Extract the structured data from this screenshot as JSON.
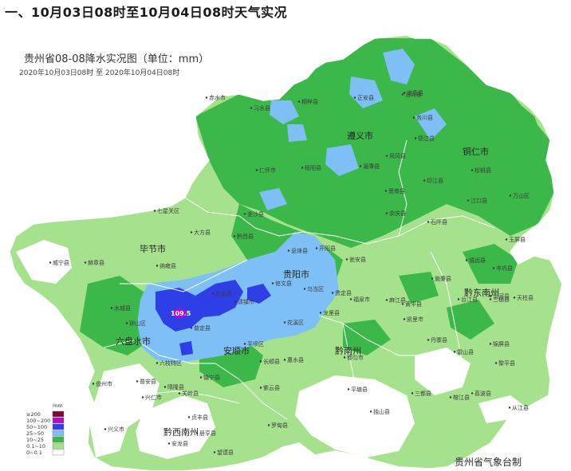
{
  "heading": "一、10月03日08时至10月04日08时天气实况",
  "map": {
    "title": "贵州省08-08降水实况图（单位：mm）",
    "period": "2020年10月03日08时  至  2020年10月04日08时",
    "credit": "贵州省气象台制",
    "max_value_label": "109.5",
    "colors": {
      "c0": "#ffffff",
      "c1": "#a6e28e",
      "c2": "#3cb84a",
      "c3": "#7ec0f5",
      "c4": "#2f3fe8",
      "c5": "#b10dc9",
      "c6": "#7a0a3a",
      "boundary": "#ffffff",
      "bg": "#ffffff"
    },
    "legend": {
      "unit": "mm",
      "items": [
        {
          "label": "≥200",
          "color": "#7a0a3a"
        },
        {
          "label": "100~200",
          "color": "#b10dc9"
        },
        {
          "label": "50~100",
          "color": "#2f3fe8"
        },
        {
          "label": "25~50",
          "color": "#7ec0f5"
        },
        {
          "label": "10~25",
          "color": "#3cb84a"
        },
        {
          "label": "0.1~10",
          "color": "#a6e28e"
        },
        {
          "label": "0~0.1",
          "color": "#ffffff"
        }
      ]
    },
    "prefectures": [
      "遵义市",
      "铜仁市",
      "毕节市",
      "贵阳市",
      "六盘水市",
      "安顺市",
      "黔南州",
      "黔东南州",
      "黔西南州"
    ],
    "counties": [
      "赤水市",
      "习水县",
      "桐梓县",
      "正安县",
      "道真县",
      "务川县",
      "凤冈县",
      "湄潭县",
      "余庆县",
      "绥阳县",
      "仁怀市",
      "金沙县",
      "七星关区",
      "大方县",
      "黔西县",
      "织金县",
      "纳雍县",
      "赫章县",
      "威宁县",
      "水城县",
      "钟山区",
      "盘州市",
      "六枝特区",
      "普定县",
      "镇宁县",
      "关岭县",
      "紫云县",
      "平坝区",
      "清镇市",
      "修文县",
      "息烽县",
      "开阳县",
      "乌当区",
      "花溪区",
      "龙里县",
      "贵定县",
      "惠水县",
      "长顺县",
      "罗甸县",
      "平塘县",
      "独山县",
      "都匀市",
      "三都县",
      "荔波县",
      "兴义市",
      "兴仁市",
      "安龙县",
      "册亨县",
      "望谟县",
      "贞丰县",
      "普安县",
      "晴隆县",
      "江口县",
      "石阡县",
      "思南县",
      "印江县",
      "德江县",
      "沿河县",
      "松桃县",
      "万山区",
      "玉屏县",
      "岑巩县",
      "镇远县",
      "施秉县",
      "黄平县",
      "凯里市",
      "麻江县",
      "丹寨县",
      "雷山县",
      "台江县",
      "剑河县",
      "三穗县",
      "天柱县",
      "锦屏县",
      "黎平县",
      "榕江县",
      "从江县",
      "福泉市",
      "瓮安县"
    ]
  }
}
